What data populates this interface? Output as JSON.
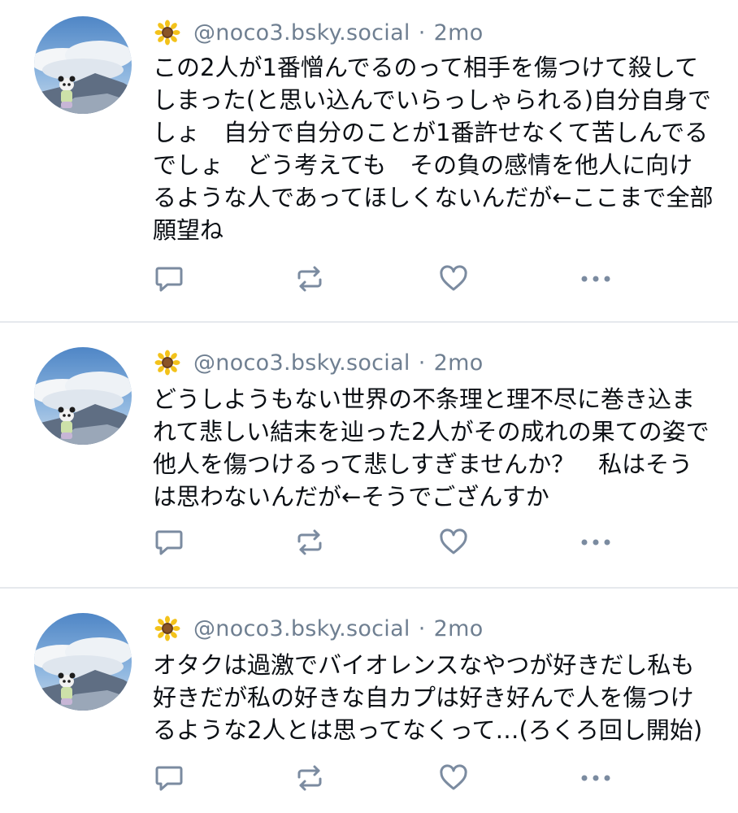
{
  "colors": {
    "muted": "#6f7f91",
    "text": "#0b0f14",
    "divider": "#e6e9ed",
    "action_icon": "#7b8ba0"
  },
  "posts": [
    {
      "handle": "@noco3.bsky.social",
      "separator": "·",
      "time": "2mo",
      "text": "この2人が1番憎んでるのって相手を傷つけて殺してしまった(と思い込んでいらっしゃられる)自分自身でしょ　自分で自分のことが1番許せなくて苦しんでるでしょ　どう考えても　その負の感情を他人に向けるような人であってほしくないんだが←ここまで全部願望ね",
      "icons": [
        "reply-icon",
        "repost-icon",
        "like-icon",
        "more-icon"
      ]
    },
    {
      "handle": "@noco3.bsky.social",
      "separator": "·",
      "time": "2mo",
      "text": "どうしようもない世界の不条理と理不尽に巻き込まれて悲しい結末を辿った2人がその成れの果ての姿で他人を傷つけるって悲しすぎませんか？　私はそうは思わないんだが←そうでござんすか",
      "icons": [
        "reply-icon",
        "repost-icon",
        "like-icon",
        "more-icon"
      ]
    },
    {
      "handle": "@noco3.bsky.social",
      "separator": "·",
      "time": "2mo",
      "text": "オタクは過激でバイオレンスなやつが好きだし私も好きだが私の好きな自カプは好き好んで人を傷つけるような2人とは思ってなくって…(ろくろ回し開始)",
      "icons": [
        "reply-icon",
        "repost-icon",
        "like-icon",
        "more-icon"
      ]
    }
  ]
}
